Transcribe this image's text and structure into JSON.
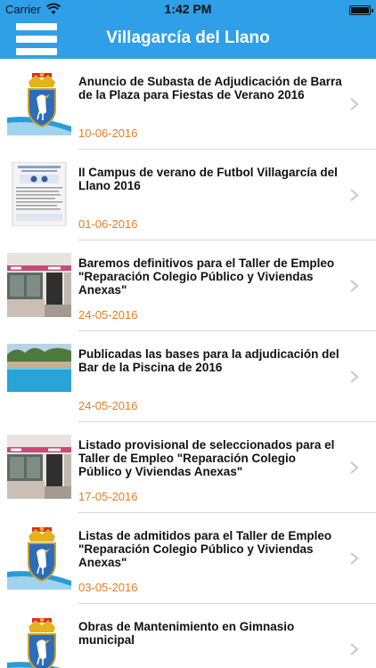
{
  "status": {
    "carrier": "Carrier",
    "time": "1:42 PM"
  },
  "nav": {
    "title": "Villagarcía del Llano"
  },
  "colors": {
    "nav_bg": "#2f9fe8",
    "date": "#e67e22",
    "separator": "#d7d7d7"
  },
  "news": [
    {
      "title": "Anuncio de Subasta de Adjudicación de Barra de la Plaza para Fiestas de Verano 2016",
      "date": "10-06-2016",
      "thumbnail": "coat-of-arms-icon"
    },
    {
      "title": "II Campus de verano de Futbol Villagarcía del Llano 2016",
      "date": "01-06-2016",
      "thumbnail": "poster-thumbnail"
    },
    {
      "title": "Baremos definitivos para el Taller de Empleo \"Reparación Colegio Público y Viviendas Anexas\"",
      "date": "24-05-2016",
      "thumbnail": "building-photo"
    },
    {
      "title": "Publicadas las bases para la adjudicación del Bar de la Piscina de 2016",
      "date": "24-05-2016",
      "thumbnail": "pool-photo"
    },
    {
      "title": "Listado provisional de seleccionados para el Taller de Empleo \"Reparación Colegio Público y Viviendas Anexas\"",
      "date": "17-05-2016",
      "thumbnail": "building-photo"
    },
    {
      "title": "Listas de admitidos para el Taller de Empleo \"Reparación Colegio Público y Viviendas Anexas\"",
      "date": "03-05-2016",
      "thumbnail": "coat-of-arms-icon"
    },
    {
      "title": "Obras de Mantenimiento en Gimnasio municipal",
      "date": "",
      "thumbnail": "coat-of-arms-icon"
    }
  ]
}
